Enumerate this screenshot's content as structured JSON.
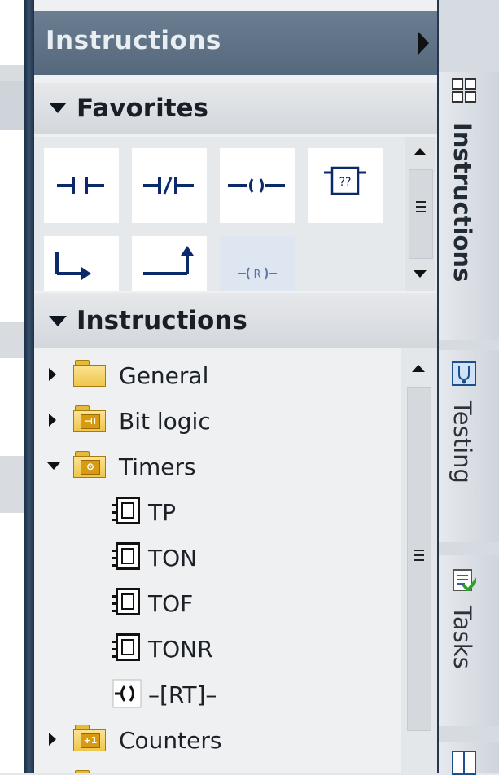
{
  "panel": {
    "title": "Instructions",
    "favorites": {
      "label": "Favorites",
      "buttons": [
        {
          "name": "normally-open-contact",
          "glyph": "contact-no"
        },
        {
          "name": "normally-closed-contact",
          "glyph": "contact-nc"
        },
        {
          "name": "assignment-coil",
          "glyph": "coil"
        },
        {
          "name": "empty-box",
          "glyph": "box",
          "text": "??"
        },
        {
          "name": "open-branch",
          "glyph": "branch-open"
        },
        {
          "name": "close-branch",
          "glyph": "branch-close"
        },
        {
          "name": "reset-coil",
          "glyph": "reset",
          "text": "R"
        }
      ]
    },
    "instructions": {
      "label": "Instructions",
      "tree": [
        {
          "label": "General",
          "icon": "folder-icon",
          "expanded": false,
          "level": 0
        },
        {
          "label": "Bit logic",
          "icon": "bit-logic-folder-icon",
          "badge": "⊣I",
          "expanded": false,
          "level": 0
        },
        {
          "label": "Timers",
          "icon": "timer-folder-icon",
          "badge": "⏲",
          "expanded": true,
          "level": 0
        },
        {
          "label": "TP",
          "icon": "function-block-icon",
          "level": 1
        },
        {
          "label": "TON",
          "icon": "function-block-icon",
          "level": 1
        },
        {
          "label": "TOF",
          "icon": "function-block-icon",
          "level": 1
        },
        {
          "label": "TONR",
          "icon": "function-block-icon",
          "level": 1
        },
        {
          "label": "–[RT]–",
          "icon": "coil-instruction-icon",
          "level": 1
        },
        {
          "label": "Counters",
          "icon": "counter-folder-icon",
          "badge": "+1",
          "expanded": false,
          "level": 0
        }
      ]
    }
  },
  "sidetabs": [
    {
      "label": "Instructions",
      "icon": "grid-icon",
      "active": true
    },
    {
      "label": "Testing",
      "icon": "testing-icon",
      "active": false
    },
    {
      "label": "Tasks",
      "icon": "tasks-icon",
      "active": false
    }
  ],
  "colors": {
    "header": "#5f7186",
    "frame": "#1d3046",
    "folder": "#efc64c",
    "highlight": "#dde6f1"
  }
}
